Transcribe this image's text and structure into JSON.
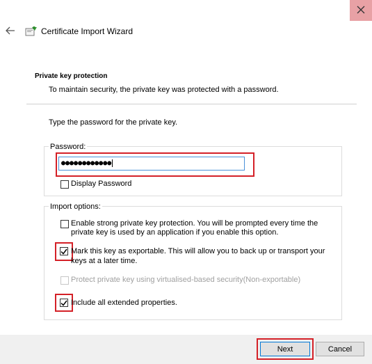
{
  "window": {
    "title": "Certificate Import Wizard",
    "close_icon": "close-icon",
    "back_icon": "back-arrow-icon",
    "wizard_icon": "certificate-icon"
  },
  "section": {
    "title": "Private key protection",
    "description": "To maintain security, the private key was protected with a password."
  },
  "prompt": "Type the password for the private key.",
  "password_group": {
    "label": "Password:",
    "value": "●●●●●●●●●●●●",
    "display_password": {
      "label": "Display Password",
      "checked": false
    }
  },
  "import_options": {
    "label": "Import options:",
    "options": [
      {
        "line1": "Enable strong private key protection. You will be prompted every time the",
        "line2": "private key is used by an application if you enable this option.",
        "checked": false,
        "enabled": true
      },
      {
        "line1": "Mark this key as exportable. This will allow you to back up or transport your",
        "line2": "keys at a later time.",
        "checked": true,
        "enabled": true
      },
      {
        "line1": "Protect private key using virtualised-based security(Non-exportable)",
        "line2": "",
        "checked": false,
        "enabled": false
      },
      {
        "line1": "Include all extended properties.",
        "line2": "",
        "checked": true,
        "enabled": true
      }
    ]
  },
  "footer": {
    "next_label": "Next",
    "cancel_label": "Cancel"
  },
  "colors": {
    "highlight": "#d42027",
    "close_bg": "#e8a1a5",
    "focus_border": "#4a90d9",
    "primary_border": "#0078d7"
  }
}
